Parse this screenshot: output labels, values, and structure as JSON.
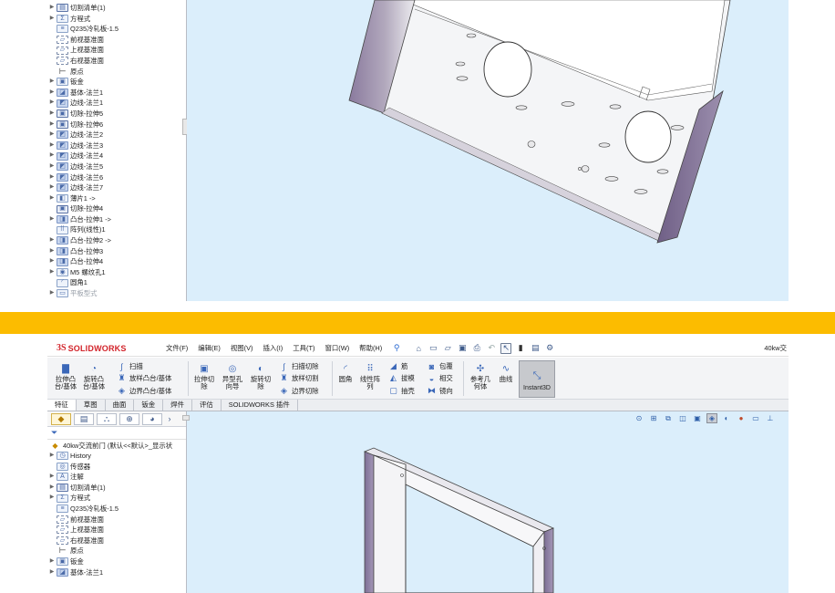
{
  "top_panel": {
    "tree_items": [
      {
        "label": "切割清单(1)",
        "icon": "cut-list-icon",
        "expandable": true
      },
      {
        "label": "方程式",
        "icon": "equation-icon",
        "expandable": true
      },
      {
        "label": "Q235冷轧板-1.5",
        "icon": "material-icon",
        "expandable": false
      },
      {
        "label": "前视基准面",
        "icon": "plane-icon",
        "expandable": false
      },
      {
        "label": "上视基准面",
        "icon": "plane-icon",
        "expandable": false
      },
      {
        "label": "右视基准面",
        "icon": "plane-icon",
        "expandable": false
      },
      {
        "label": "原点",
        "icon": "origin-icon",
        "expandable": false
      },
      {
        "label": "钣金",
        "icon": "sheet-metal-icon",
        "expandable": true
      },
      {
        "label": "基体-法兰1",
        "icon": "base-flange-icon",
        "expandable": true
      },
      {
        "label": "边线-法兰1",
        "icon": "edge-flange-icon",
        "expandable": true
      },
      {
        "label": "切除-拉伸5",
        "icon": "cut-extrude-icon",
        "expandable": true
      },
      {
        "label": "切除-拉伸6",
        "icon": "cut-extrude-icon",
        "expandable": true
      },
      {
        "label": "边线-法兰2",
        "icon": "edge-flange-icon",
        "expandable": true
      },
      {
        "label": "边线-法兰3",
        "icon": "edge-flange-icon",
        "expandable": true
      },
      {
        "label": "边线-法兰4",
        "icon": "edge-flange-icon",
        "expandable": true
      },
      {
        "label": "边线-法兰5",
        "icon": "edge-flange-icon",
        "expandable": true
      },
      {
        "label": "边线-法兰6",
        "icon": "edge-flange-icon",
        "expandable": true
      },
      {
        "label": "边线-法兰7",
        "icon": "edge-flange-icon",
        "expandable": true
      },
      {
        "label": "薄片1 ->",
        "icon": "tab-feature-icon",
        "expandable": true
      },
      {
        "label": "切除-拉伸4",
        "icon": "cut-extrude-icon",
        "expandable": false
      },
      {
        "label": "凸台-拉伸1 ->",
        "icon": "boss-extrude-icon",
        "expandable": true
      },
      {
        "label": "阵列(线性)1",
        "icon": "linear-pattern-icon",
        "expandable": false
      },
      {
        "label": "凸台-拉伸2 ->",
        "icon": "boss-extrude-icon",
        "expandable": true
      },
      {
        "label": "凸台-拉伸3",
        "icon": "boss-extrude-icon",
        "expandable": true
      },
      {
        "label": "凸台-拉伸4",
        "icon": "boss-extrude-icon",
        "expandable": true
      },
      {
        "label": "M5 螺纹孔1",
        "icon": "hole-icon",
        "expandable": true
      },
      {
        "label": "圆角1",
        "icon": "fillet-icon",
        "expandable": false
      },
      {
        "label": "平板型式",
        "icon": "flat-pattern-icon",
        "expandable": true,
        "faded": true
      }
    ]
  },
  "window": {
    "brand_ds": "3S",
    "brand_name": "SOLIDWORKS",
    "menus": [
      "文件(F)",
      "编辑(E)",
      "视图(V)",
      "插入(I)",
      "工具(T)",
      "窗口(W)",
      "帮助(H)"
    ],
    "document_title": "40kw交"
  },
  "ribbon": {
    "extrude_boss": "拉伸凸\n台/基体",
    "revolve_boss": "旋转凸\n台/基体",
    "sweep": "扫描",
    "loft": "放样凸台/基体",
    "boundary_boss": "边界凸台/基体",
    "extrude_cut": "拉伸切\n除",
    "hole_wizard": "异型孔\n向导",
    "revolve_cut": "旋转切\n除",
    "swept_cut": "扫描切除",
    "lofted_cut": "放样切割",
    "boundary_cut": "边界切除",
    "fillet": "圆角",
    "linear_pattern": "线性阵\n列",
    "rib": "筋",
    "draft": "拔模",
    "shell": "抽壳",
    "wrap": "包覆",
    "intersect": "相交",
    "mirror": "镜向",
    "reference_geometry": "参考几\n何体",
    "curves": "曲线",
    "instant3d": "Instant3D"
  },
  "command_tabs": [
    {
      "label": "特征",
      "active": true
    },
    {
      "label": "草图",
      "active": false
    },
    {
      "label": "曲面",
      "active": false
    },
    {
      "label": "钣金",
      "active": false
    },
    {
      "label": "焊件",
      "active": false
    },
    {
      "label": "评估",
      "active": false
    },
    {
      "label": "SOLIDWORKS 插件",
      "active": false
    }
  ],
  "bottom_panel": {
    "part_name": "40kw交流前门  (默认<<默认>_显示状",
    "tree_items": [
      {
        "label": "History",
        "icon": "history-icon",
        "expandable": true
      },
      {
        "label": "传感器",
        "icon": "sensor-icon",
        "expandable": false
      },
      {
        "label": "注解",
        "icon": "annotation-icon",
        "expandable": true
      },
      {
        "label": "切割清单(1)",
        "icon": "cut-list-icon",
        "expandable": true
      },
      {
        "label": "方程式",
        "icon": "equation-icon",
        "expandable": true
      },
      {
        "label": "Q235冷轧板-1.5",
        "icon": "material-icon",
        "expandable": false
      },
      {
        "label": "前视基准面",
        "icon": "plane-icon",
        "expandable": false
      },
      {
        "label": "上视基准面",
        "icon": "plane-icon",
        "expandable": false
      },
      {
        "label": "右视基准面",
        "icon": "plane-icon",
        "expandable": false
      },
      {
        "label": "原点",
        "icon": "origin-icon",
        "expandable": false
      },
      {
        "label": "钣金",
        "icon": "sheet-metal-icon",
        "expandable": true
      },
      {
        "label": "基体-法兰1",
        "icon": "base-flange-icon",
        "expandable": true
      }
    ]
  },
  "colors": {
    "viewport_bg": "#dbeefb",
    "separator": "#fcbc00",
    "brand": "#d2232a",
    "metal_face": "#8e7fa3"
  }
}
